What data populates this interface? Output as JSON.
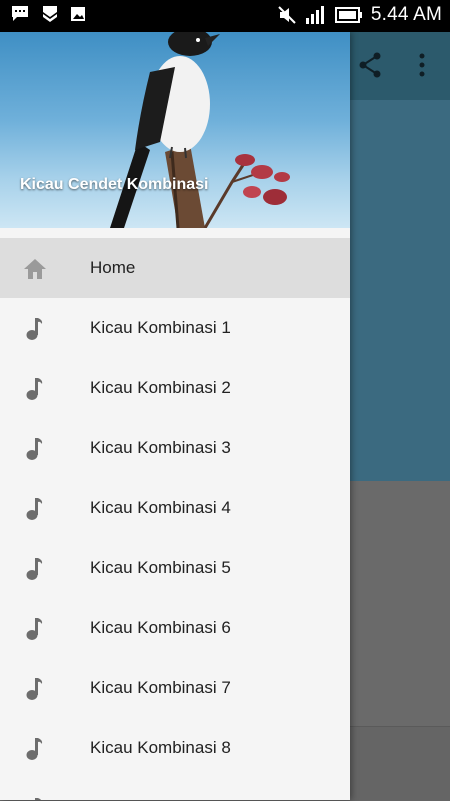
{
  "status_bar": {
    "time": "5.44 AM",
    "left_icons": [
      "chat-notification-icon",
      "shield-icon",
      "image-icon"
    ],
    "right_icons": [
      "mute-icon",
      "signal-icon",
      "battery-icon"
    ]
  },
  "toolbar": {
    "actions": [
      "share-icon",
      "overflow-menu-icon"
    ]
  },
  "drawer": {
    "header_title": "Kicau Cendet Kombinasi",
    "items": [
      {
        "label": "Home",
        "icon": "home-icon",
        "active": true
      },
      {
        "label": "Kicau Kombinasi 1",
        "icon": "music-note-icon"
      },
      {
        "label": "Kicau Kombinasi 2",
        "icon": "music-note-icon"
      },
      {
        "label": "Kicau Kombinasi 3",
        "icon": "music-note-icon"
      },
      {
        "label": "Kicau Kombinasi 4",
        "icon": "music-note-icon"
      },
      {
        "label": "Kicau Kombinasi 5",
        "icon": "music-note-icon"
      },
      {
        "label": "Kicau Kombinasi 6",
        "icon": "music-note-icon"
      },
      {
        "label": "Kicau Kombinasi 7",
        "icon": "music-note-icon"
      },
      {
        "label": "Kicau Kombinasi 8",
        "icon": "music-note-icon"
      }
    ]
  },
  "colors": {
    "toolbar": "#2c5a6c",
    "drawer_bg": "#f5f5f5",
    "active_item": "#dddddd",
    "icon_gray": "#6d6d6d"
  }
}
